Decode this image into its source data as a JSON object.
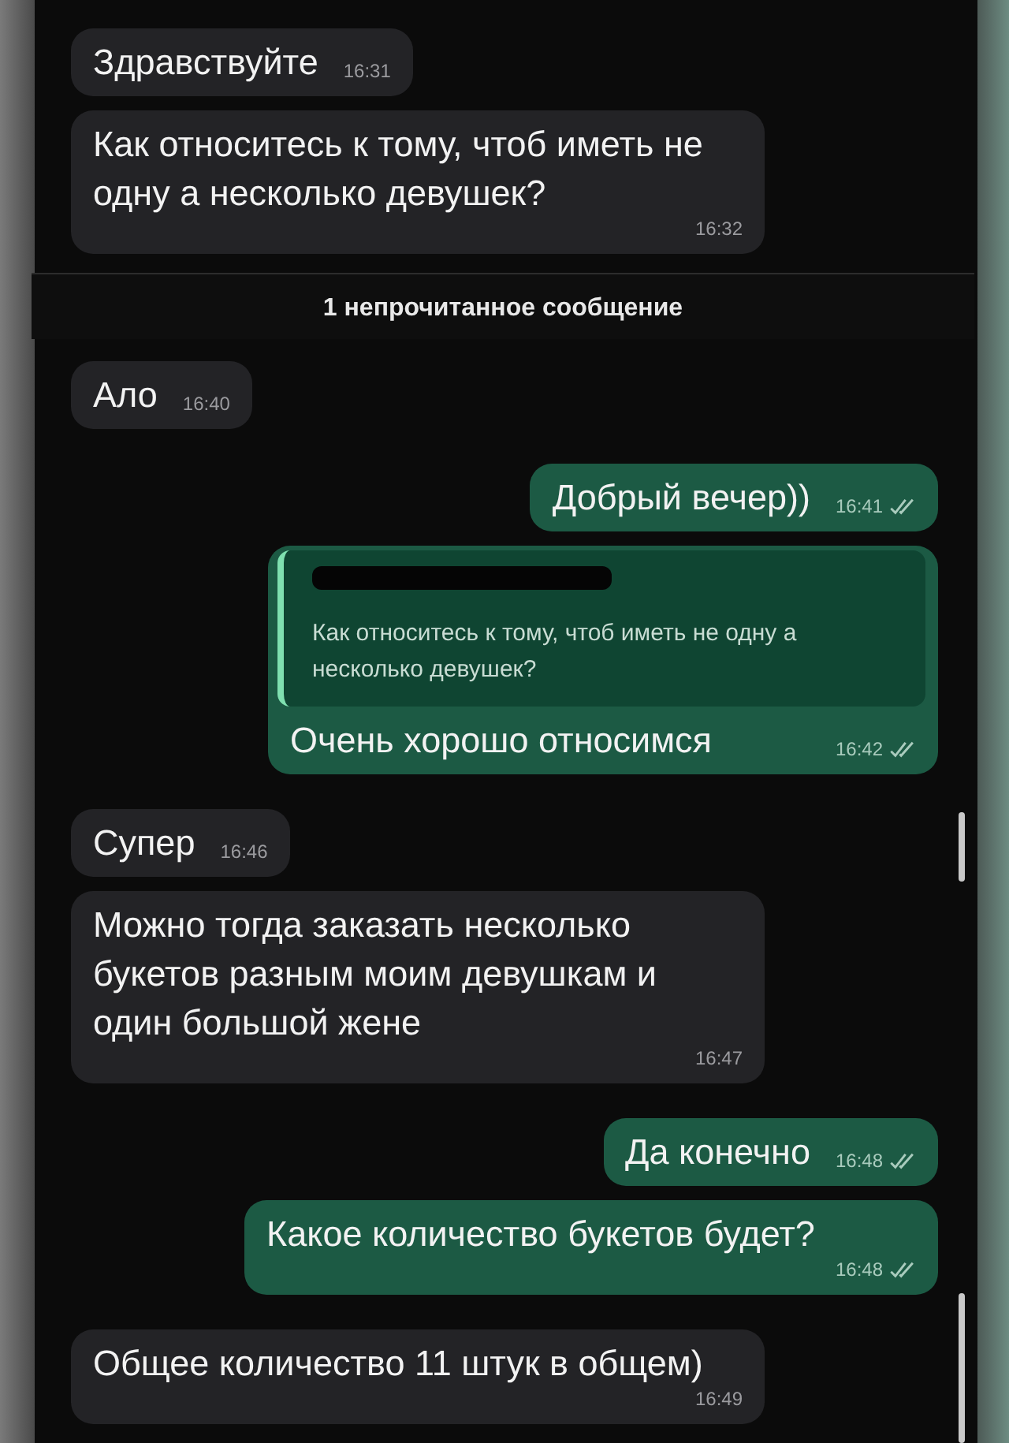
{
  "messages": [
    {
      "kind": "incoming",
      "text": "Здравствуйте",
      "time": "16:31"
    },
    {
      "kind": "incoming",
      "text": "Как относитесь к тому, чтоб иметь не одну а несколько девушек?",
      "time": "16:32"
    },
    {
      "kind": "unread_divider",
      "text": "1 непрочитанное сообщение"
    },
    {
      "kind": "incoming",
      "text": "Ало",
      "time": "16:40"
    },
    {
      "kind": "outgoing",
      "text": "Добрый вечер))",
      "time": "16:41",
      "read": true
    },
    {
      "kind": "outgoing",
      "quote": {
        "text": "Как относитесь к тому, чтоб иметь не одну а несколько девушек?"
      },
      "text": "Очень хорошо относимся",
      "time": "16:42",
      "read": true
    },
    {
      "kind": "incoming",
      "text": "Супер",
      "time": "16:46"
    },
    {
      "kind": "incoming",
      "text": "Можно тогда заказать несколько букетов разным моим девушкам и один большой жене",
      "time": "16:47"
    },
    {
      "kind": "outgoing",
      "text": "Да конечно",
      "time": "16:48",
      "read": true
    },
    {
      "kind": "outgoing",
      "text": "Какое количество букетов будет?",
      "time": "16:48",
      "read": true
    },
    {
      "kind": "incoming",
      "text": "Общее количество 11 штук в общем)",
      "time": "16:49"
    }
  ]
}
